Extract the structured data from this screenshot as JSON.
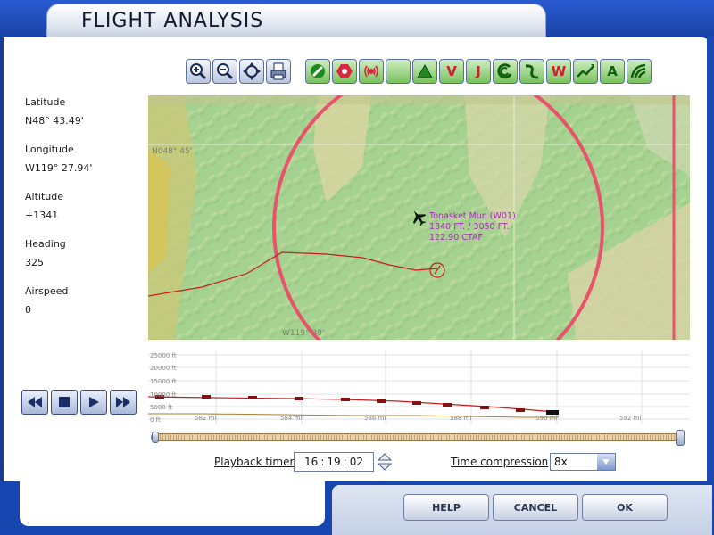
{
  "window": {
    "title": "FLIGHT ANALYSIS"
  },
  "toolbar": {
    "buttons": [
      {
        "icon": "zoom-in-icon"
      },
      {
        "icon": "zoom-out-icon"
      },
      {
        "icon": "center-aircraft-icon"
      },
      {
        "icon": "print-icon"
      },
      {
        "icon": "airport-icon"
      },
      {
        "icon": "vor-icon"
      },
      {
        "icon": "ndb-icon"
      },
      {
        "icon": "ils-icon"
      },
      {
        "icon": "intersection-icon"
      },
      {
        "icon": "victor-airway-icon",
        "label": "V"
      },
      {
        "icon": "jet-airway-icon",
        "label": "J"
      },
      {
        "icon": "airspace-icon"
      },
      {
        "icon": "route-icon"
      },
      {
        "icon": "weather-icon",
        "label": "W"
      },
      {
        "icon": "flight-path-icon"
      },
      {
        "icon": "altitude-icon",
        "label": "A"
      },
      {
        "icon": "terrain-icon"
      }
    ]
  },
  "info": {
    "latitude_label": "Latitude",
    "latitude_value": "N48° 43.49'",
    "longitude_label": "Longitude",
    "longitude_value": "W119° 27.94'",
    "altitude_label": "Altitude",
    "altitude_value": "+1341",
    "heading_label": "Heading",
    "heading_value": "325",
    "airspeed_label": "Airspeed",
    "airspeed_value": "0"
  },
  "map": {
    "grid_label_top": "N048° 45'",
    "grid_label_bottom": "W119° 30'",
    "airport_name": "Tonasket Mun (W01)",
    "airport_elev": "1340  FT. / 3050  FT.",
    "airport_freq": "122.90 CTAF",
    "colors": {
      "terrain_low": "#a9d392",
      "terrain_high": "#d9d79a",
      "airspace": "#e8526a",
      "track": "#c41e1e"
    }
  },
  "profile": {
    "altitude_labels": [
      "25000 ft",
      "20000 ft",
      "15000 ft",
      "10000 ft",
      "5000 ft",
      "0 ft"
    ],
    "distance_labels": [
      "582 mi",
      "584 mi",
      "586 mi",
      "588 mi",
      "590 mi",
      "592 mi"
    ]
  },
  "playback": {
    "timer_label": "Playback timer",
    "hh": "16",
    "mm": "19",
    "ss": "02",
    "time_compression_label": "Time compression",
    "time_compression_value": "8x"
  },
  "footer": {
    "help": "HELP",
    "cancel": "CANCEL",
    "ok": "OK"
  }
}
